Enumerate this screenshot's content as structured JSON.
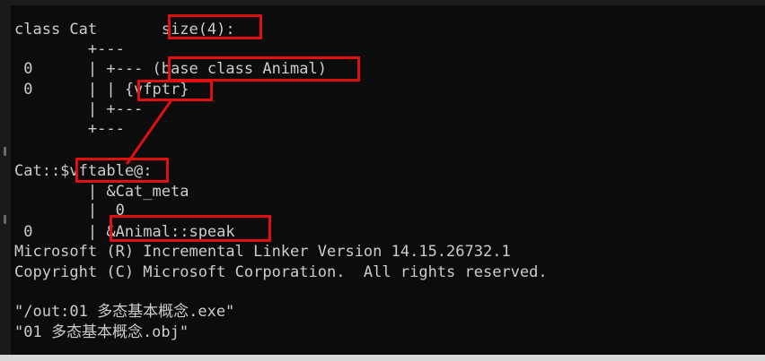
{
  "console": {
    "lines": [
      "class Cat       size(4):",
      "        +---",
      " 0      | +--- (base class Animal)",
      " 0      | | {vfptr}",
      "        | +---",
      "        +---",
      "",
      "Cat::$vftable@:",
      "        | &Cat_meta",
      "        |  0",
      " 0      | &Animal::speak",
      "Microsoft (R) Incremental Linker Version 14.15.26732.1",
      "Copyright (C) Microsoft Corporation.  All rights reserved.",
      "",
      "\"/out:01 多态基本概念.exe\"",
      "\"01 多态基本概念.obj\""
    ]
  },
  "annotations": {
    "color": "#e01010"
  }
}
